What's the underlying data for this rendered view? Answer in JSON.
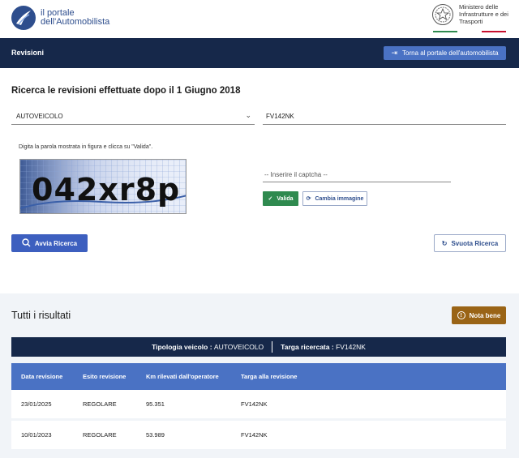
{
  "header": {
    "logo_line1": "il portale",
    "logo_line2": "dell'Automobilista",
    "ministry_line1": "Ministero delle",
    "ministry_line2": "Infrastrutture e dei",
    "ministry_line3": "Trasporti",
    "flag_colors": [
      "#2f8a4f",
      "#ffffff",
      "#c8102e"
    ]
  },
  "navbar": {
    "title": "Revisioni",
    "back_label": "Torna al portale dell'automobilista"
  },
  "search": {
    "title": "Ricerca le revisioni effettuate dopo il 1 Giugno 2018",
    "vehicle_type": "AUTOVEICOLO",
    "plate_value": "FV142NK",
    "captcha_hint": "Digita la parola mostrata in figura e clicca su \"Valida\".",
    "captcha_text": "042xr8p",
    "captcha_placeholder": "-- Inserire il captcha --",
    "valida_label": "Valida",
    "cambia_label": "Cambia immagine",
    "avvia_label": "Avvia Ricerca",
    "svuota_label": "Svuota Ricerca"
  },
  "results": {
    "title": "Tutti i risultati",
    "nota_label": "Nota bene",
    "summary_type_label": "Tipologia veicolo :",
    "summary_type_value": "AUTOVEICOLO",
    "summary_plate_label": "Targa ricercata :",
    "summary_plate_value": "FV142NK",
    "columns": [
      "Data revisione",
      "Esito revisione",
      "Km rilevati dall'operatore",
      "Targa alla revisione"
    ],
    "rows": [
      [
        "23/01/2025",
        "REGOLARE",
        "95.351",
        "FV142NK"
      ],
      [
        "10/01/2023",
        "REGOLARE",
        "53.989",
        "FV142NK"
      ]
    ]
  },
  "colors": {
    "navy": "#16284a",
    "blue": "#4a72c4",
    "green": "#2f8a4f",
    "brown": "#9a6416"
  }
}
